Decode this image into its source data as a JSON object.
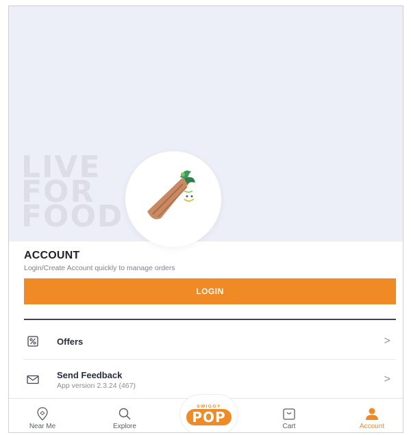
{
  "hero": {
    "watermark": [
      "LIVE",
      "FOR",
      "FOOD"
    ]
  },
  "account": {
    "title": "ACCOUNT",
    "subtitle": "Login/Create Account quickly to manage orders",
    "login_label": "LOGIN"
  },
  "menu": {
    "items": [
      {
        "label": "Offers",
        "icon": "offers-percent-icon"
      },
      {
        "label": "Send Feedback",
        "sub": "App version 2.3.24 (467)",
        "icon": "envelope-icon"
      }
    ],
    "chevron": ">"
  },
  "bottom_nav": {
    "items": [
      {
        "label": "Near Me",
        "icon": "location-pin-icon"
      },
      {
        "label": "Explore",
        "icon": "search-icon"
      },
      {
        "label": "Cart",
        "icon": "cart-bag-icon"
      },
      {
        "label": "Account",
        "icon": "account-person-icon",
        "active": true
      }
    ],
    "pop": {
      "brand": "SWIGGY",
      "label": "POP"
    }
  },
  "colors": {
    "accent": "#f08a24",
    "hero_bg": "#eceef8",
    "text_dark": "#282c3f",
    "text_muted": "#7e808c"
  }
}
